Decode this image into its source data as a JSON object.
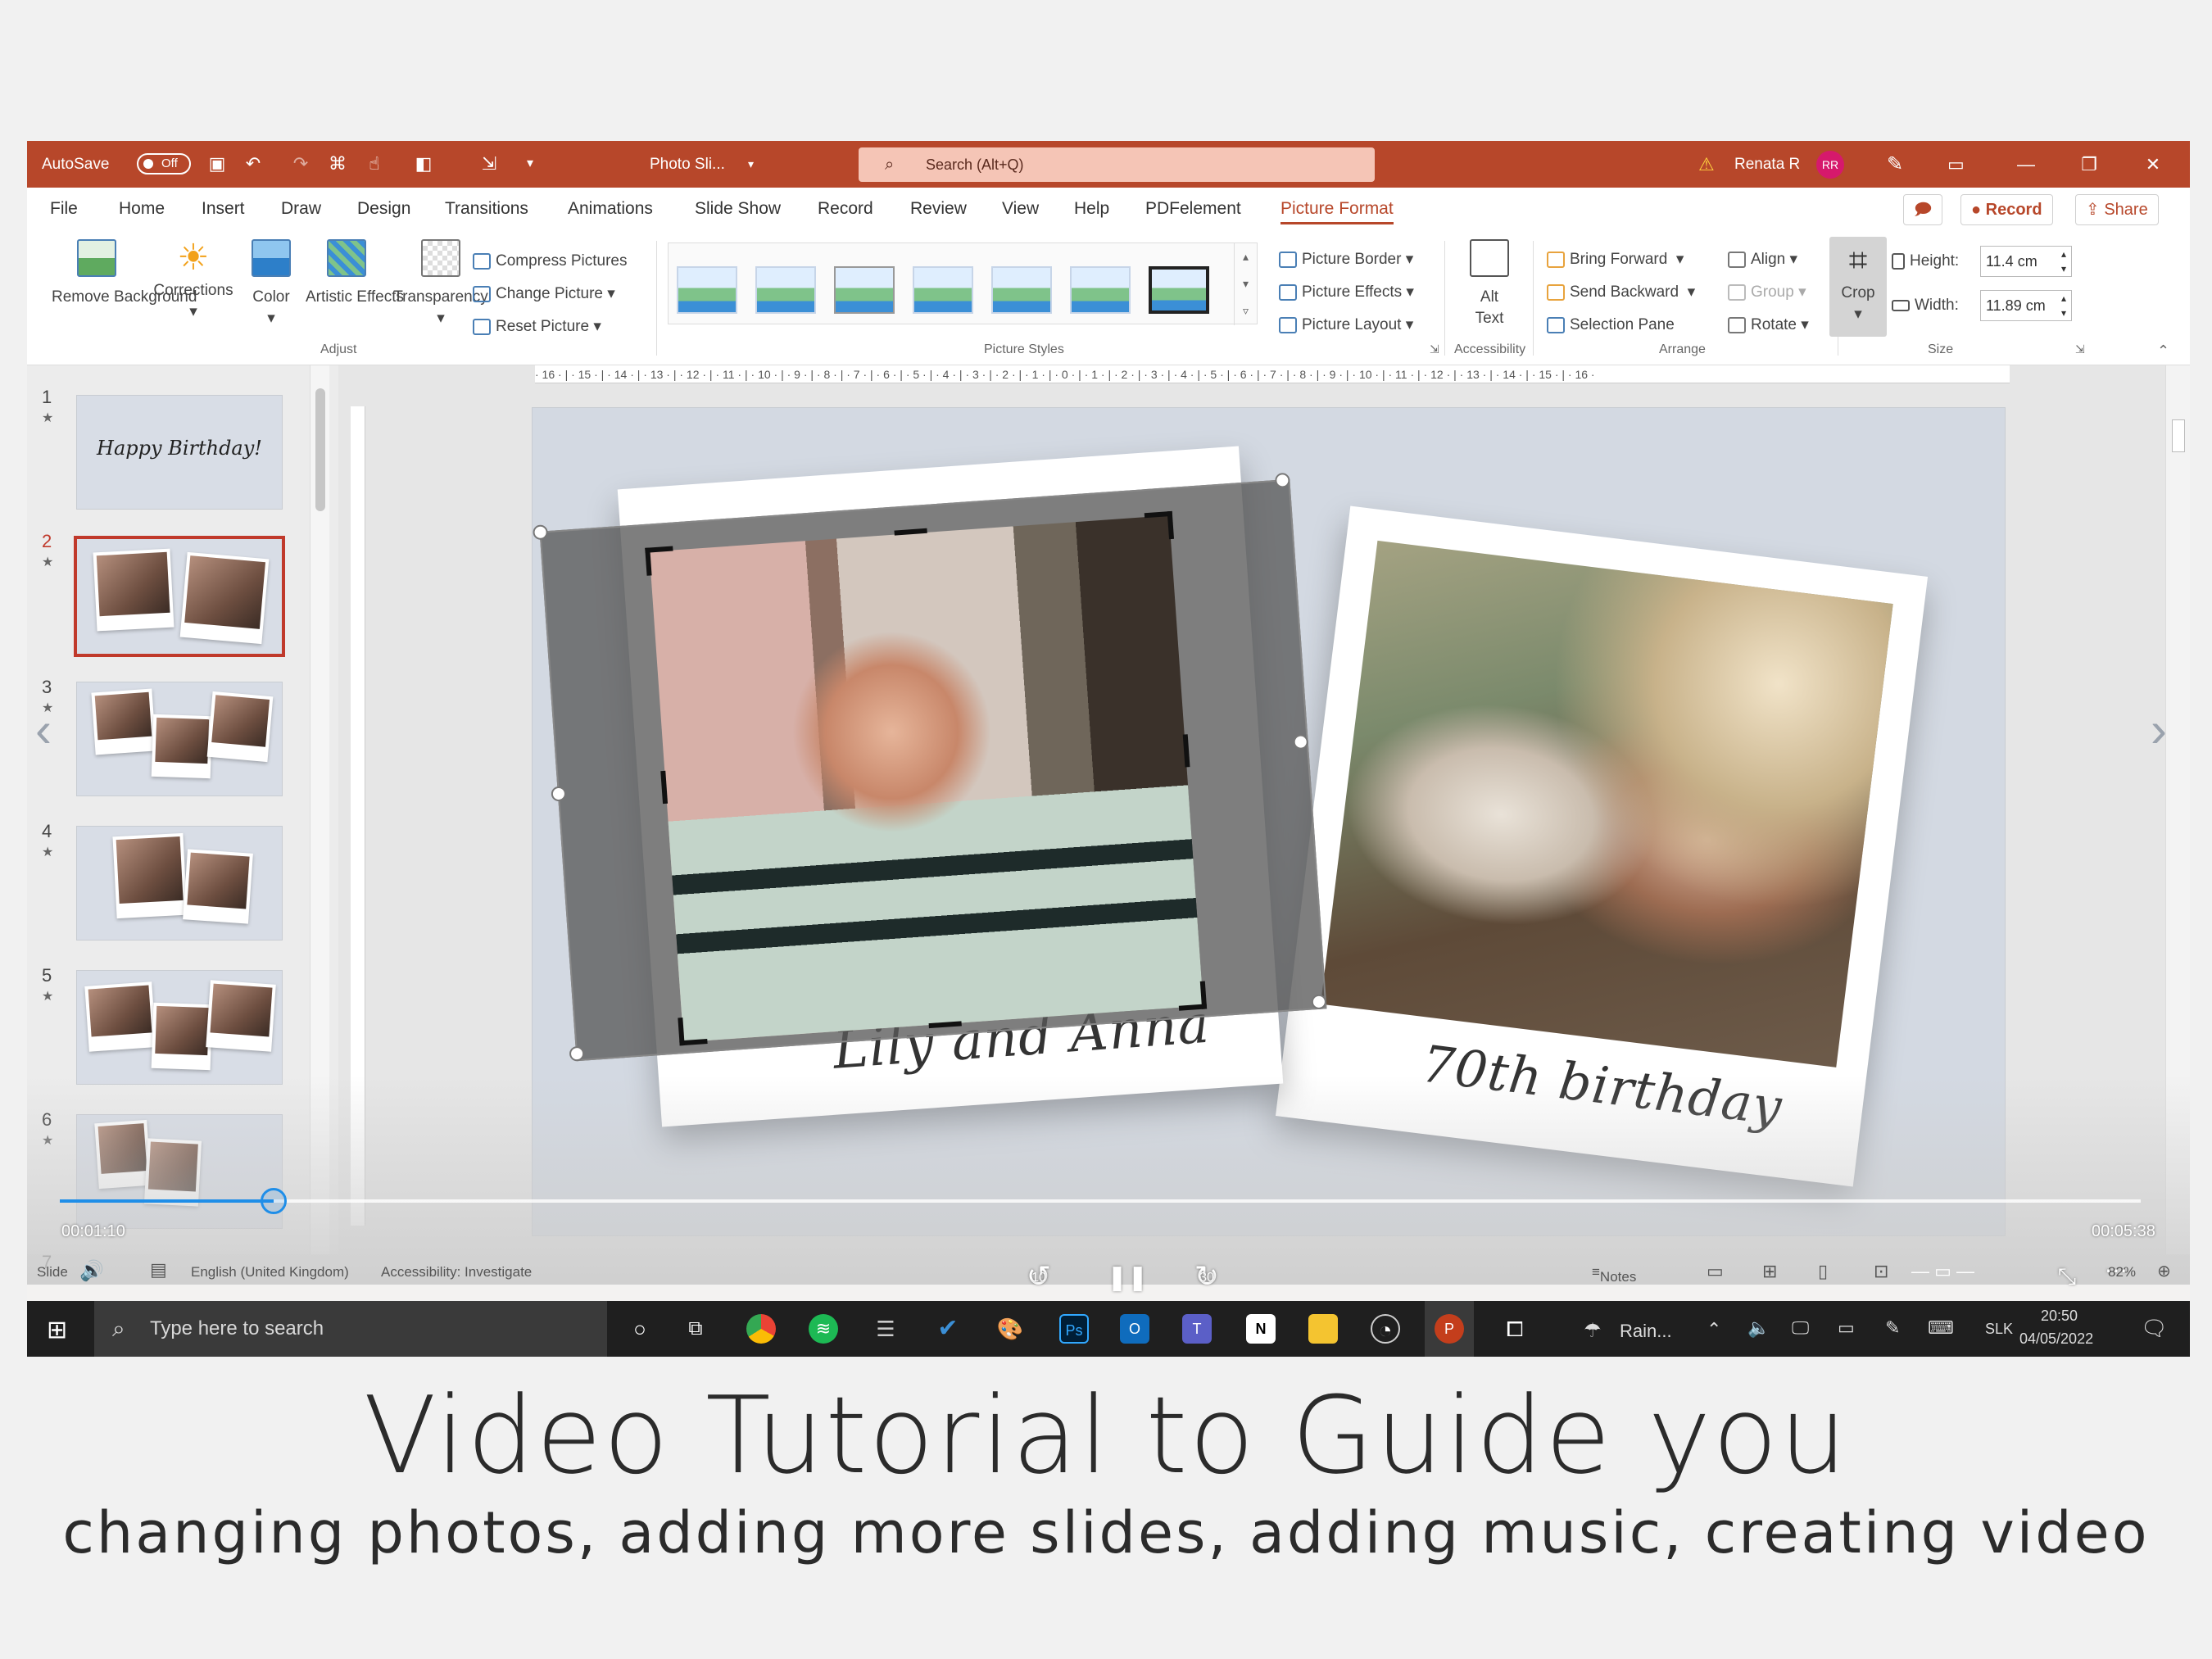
{
  "titlebar": {
    "autosave_label": "AutoSave",
    "autosave_state": "Off",
    "doc_name": "Photo Sli...",
    "search_placeholder": "Search (Alt+Q)",
    "user_name": "Renata R",
    "user_initials": "RR",
    "accent_color": "#b7472a"
  },
  "menu": {
    "items": [
      "File",
      "Home",
      "Insert",
      "Draw",
      "Design",
      "Transitions",
      "Animations",
      "Slide Show",
      "Record",
      "Review",
      "View",
      "Help",
      "PDFelement",
      "Picture Format"
    ],
    "active": "Picture Format",
    "record_label": "Record",
    "share_label": "Share"
  },
  "ribbon": {
    "adjust": {
      "remove_bg": "Remove Background",
      "corrections": "Corrections",
      "color": "Color",
      "artistic": "Artistic Effects",
      "transparency": "Transparency",
      "compress": "Compress Pictures",
      "change": "Change Picture",
      "reset": "Reset Picture",
      "label": "Adjust"
    },
    "styles": {
      "border": "Picture Border",
      "effects": "Picture Effects",
      "layout": "Picture Layout",
      "label": "Picture Styles"
    },
    "accessibility": {
      "alt1": "Alt",
      "alt2": "Text",
      "label": "Accessibility"
    },
    "arrange": {
      "bring_forward": "Bring Forward",
      "send_backward": "Send Backward",
      "selection_pane": "Selection Pane",
      "align": "Align",
      "group": "Group",
      "rotate": "Rotate",
      "label": "Arrange"
    },
    "size": {
      "crop": "Crop",
      "height_label": "Height:",
      "height_value": "11.4 cm",
      "width_label": "Width:",
      "width_value": "11.89 cm",
      "label": "Size"
    }
  },
  "thumbnails": {
    "numbers": [
      "1",
      "2",
      "3",
      "4",
      "5",
      "6",
      "7"
    ],
    "slide1_text": "Happy Birthday!",
    "selected": "2"
  },
  "ruler": "· 16 · | · 15 · | · 14 · | · 13 · | · 12 · | · 11 · | · 10 · | · 9 · | · 8 · | · 7 · | · 6 · | · 5 · | · 4 · | · 3 · | · 2 · | · 1 · | · 0 · | · 1 · | · 2 · | · 3 · | · 4 · | · 5 · | · 6 · | · 7 · | · 8 · | · 9 · | · 10 · | · 11 · | · 12 · | · 13 · | · 14 · | · 15 · | · 16 ·",
  "slide": {
    "caption_left": "Lily and Anna",
    "caption_right": "70th birthday"
  },
  "video": {
    "current_time": "00:01:10",
    "total_time": "00:05:38",
    "progress": 0.1027,
    "rewind_label": "10",
    "forward_label": "30"
  },
  "statusbar": {
    "slide": "Slide",
    "language": "English (United Kingdom)",
    "accessibility": "Accessibility: Investigate",
    "notes": "Notes",
    "zoom": "82%"
  },
  "taskbar": {
    "search_placeholder": "Type here to search",
    "weather": "Rain...",
    "lang": "SLK",
    "time": "20:50",
    "date": "04/05/2022"
  },
  "caption": {
    "headline": "Video Tutorial to Guide you",
    "subline": "changing photos, adding more slides, adding music, creating video"
  }
}
